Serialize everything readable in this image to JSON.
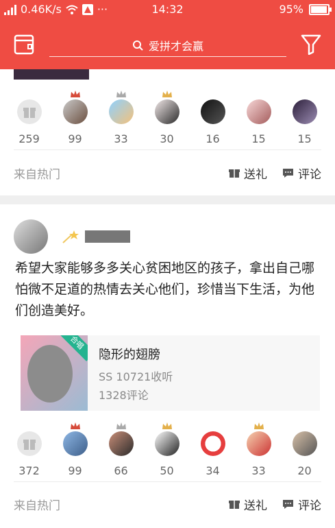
{
  "status": {
    "speed": "0.46K/s",
    "dots": "···",
    "time": "14:32",
    "battery": "95%",
    "battery_level": 0.95
  },
  "header": {
    "search_placeholder": "爱拼才会赢"
  },
  "feed": [
    {
      "gifts": [
        {
          "count": "259",
          "icon": "gift-icon"
        },
        {
          "count": "99",
          "crown": "red",
          "colors": [
            "#c9c9c9",
            "#6b4f3f"
          ]
        },
        {
          "count": "33",
          "crown": "grey",
          "colors": [
            "#8fd1ff",
            "#f4c17a"
          ]
        },
        {
          "count": "30",
          "crown": "gold",
          "colors": [
            "#f1e8e8",
            "#2a2a2a"
          ]
        },
        {
          "count": "16",
          "colors": [
            "#111111",
            "#555555"
          ]
        },
        {
          "count": "15",
          "colors": [
            "#f7d7d7",
            "#a45c5c"
          ]
        },
        {
          "count": "15",
          "colors": [
            "#2c1f3a",
            "#9b8cb2"
          ]
        }
      ],
      "source": "来自热门",
      "send_gift": "送礼",
      "comment": "评论"
    },
    {
      "text": "希望大家能够多多关心贫困地区的孩子，拿出自己哪怕微不足道的热情去关心他们，珍惜当下生活，为他们创造美好。",
      "media": {
        "tag": "合唱",
        "title": "隐形的翅膀",
        "listens": "SS  10721收听",
        "comments": "1328评论"
      },
      "gifts": [
        {
          "count": "372",
          "icon": "gift-icon"
        },
        {
          "count": "99",
          "crown": "red",
          "colors": [
            "#8db6e4",
            "#3e5f8a"
          ]
        },
        {
          "count": "66",
          "crown": "grey",
          "colors": [
            "#c98e78",
            "#2b2b2b"
          ]
        },
        {
          "count": "50",
          "crown": "gold",
          "colors": [
            "#ffffff",
            "#222222"
          ]
        },
        {
          "count": "34",
          "colors": [
            "#ffffff",
            "#e63e3e"
          ]
        },
        {
          "count": "33",
          "crown": "gold",
          "colors": [
            "#f5d2b0",
            "#c33"
          ]
        },
        {
          "count": "20",
          "colors": [
            "#d7c0a8",
            "#555555"
          ]
        }
      ],
      "source": "来自热门",
      "send_gift": "送礼",
      "comment": "评论"
    }
  ]
}
